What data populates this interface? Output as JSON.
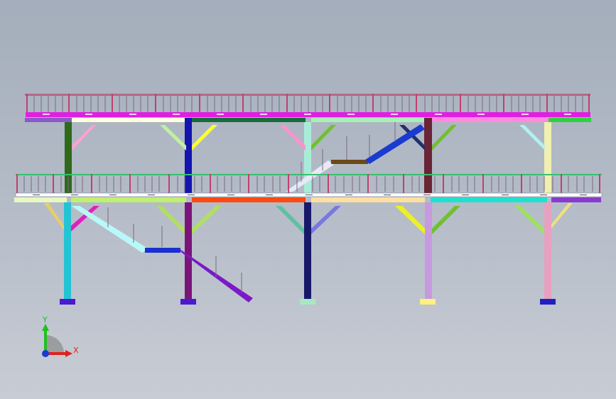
{
  "view": {
    "background_top": "#a4adbb",
    "background_bottom": "#c8ccd4"
  },
  "structure": {
    "upper_deck_colors": [
      "#d35ad3",
      "#e020e0"
    ],
    "lower_deck_color": "#ffffff",
    "railing_color": "#cc3366",
    "column_colors": [
      "#22c4d4",
      "#7a147a",
      "#18186a",
      "#c79ae0",
      "#e8a0c0"
    ],
    "upper_column_colors": [
      "#2f6a1a",
      "#1414b0",
      "#a8ecd8",
      "#6a2436",
      "#f0f0b0"
    ],
    "base_plate_colors": [
      "#4a1ad0",
      "#4a1ad0",
      "#a8e8c0",
      "#fff080",
      "#2020c0"
    ]
  },
  "triad": {
    "x_label": "X",
    "y_label": "Y",
    "x_color": "#e02020",
    "y_color": "#20c020",
    "origin_color": "#1a3ad0"
  }
}
